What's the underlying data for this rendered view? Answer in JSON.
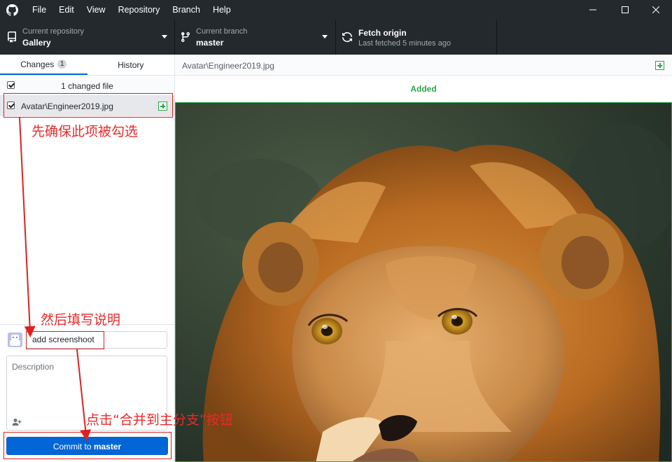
{
  "menu": [
    "File",
    "Edit",
    "View",
    "Repository",
    "Branch",
    "Help"
  ],
  "toolbar": {
    "repo_label": "Current repository",
    "repo_value": "Gallery",
    "branch_label": "Current branch",
    "branch_value": "master",
    "fetch_label": "Fetch origin",
    "fetch_sub": "Last fetched 5 minutes ago"
  },
  "tabs": {
    "changes": "Changes",
    "changes_count": "1",
    "history": "History"
  },
  "changes": {
    "count_text": "1 changed file",
    "file": "Avatar\\Engineer2019.jpg"
  },
  "commit": {
    "summary": "add screenshoot",
    "description_placeholder": "Description",
    "button_prefix": "Commit to ",
    "button_branch": "master"
  },
  "diff": {
    "path": "Avatar\\Engineer2019.jpg",
    "status": "Added"
  },
  "annotations": {
    "step1": "先确保此项被勾选",
    "step2": "然后填写说明",
    "step3": "点击“合并到主分支”按钮"
  },
  "colors": {
    "titlebar": "#24292e",
    "accent": "#0366d6",
    "added": "#28a745",
    "annotation": "#e82a2a"
  }
}
